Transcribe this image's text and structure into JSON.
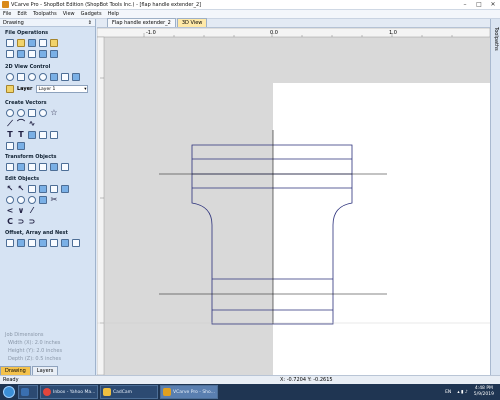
{
  "window": {
    "title": "VCarve Pro - ShopBot Edition (ShopBot Tools Inc.) - [flap handle extender_2]",
    "minimize": "–",
    "maximize": "□",
    "close": "✕"
  },
  "menu": [
    "File",
    "Edit",
    "Toolpaths",
    "View",
    "Gadgets",
    "Help"
  ],
  "sidebar": {
    "header": "Drawing",
    "pin": "⇕",
    "sections": {
      "file_ops": "File Operations",
      "view_control": "2D View Control",
      "create_vectors": "Create Vectors",
      "transform": "Transform Objects",
      "edit": "Edit Objects",
      "offset": "Offset, Array and Nest"
    },
    "layer_label": "Layer",
    "layer_value": "Layer 1",
    "job_dims": {
      "title": "Job Dimensions",
      "width": "Width  (X): 2.0 inches",
      "height": "Height (Y): 2.0 inches",
      "depth": "Depth  (Z): 0.5 inches"
    },
    "bottom_tabs": [
      "Drawing",
      "Layers"
    ]
  },
  "doc_tabs": [
    "Flap handle extender_2",
    "3D View"
  ],
  "right_panel": "Toolpaths",
  "ruler": {
    "labels": [
      "-1.0",
      "0.0",
      "1.0"
    ]
  },
  "statusbar": {
    "left": "Ready",
    "coords": "X: -0.7204 Y: -0.2615"
  },
  "taskbar": {
    "items": [
      {
        "label": "",
        "color": "#3a6fb0"
      },
      {
        "label": "Inbox - Yahoo Ma...",
        "color": "#e2453c"
      },
      {
        "label": "CadCam",
        "color": "#f0c040"
      },
      {
        "label": "VCarve Pro - Sho...",
        "color": "#e0a020"
      }
    ],
    "lang": "EN",
    "time": "4:48 PM",
    "date": "5/9/2019"
  },
  "colors": {
    "accent_tab": "#f4c24c",
    "canvas_bg": "#d9d9d9",
    "material": "#ffffff",
    "vector": "#2a2f7a"
  }
}
